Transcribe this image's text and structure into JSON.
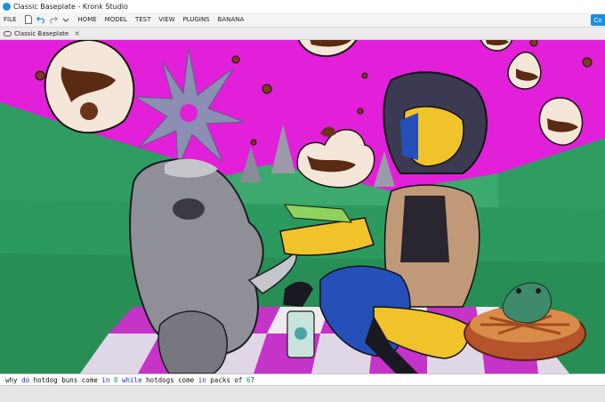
{
  "window": {
    "title": "Classic Baseplate - Kronk Studio"
  },
  "menubar": {
    "items": [
      "FILE",
      "HOME",
      "MODEL",
      "TEST",
      "VIEW",
      "PLUGINS",
      "BANANA"
    ],
    "right_button_label": "Co"
  },
  "tabs": [
    {
      "label": "Classic Baseplate"
    }
  ],
  "command_bar": {
    "segments": [
      {
        "text": "why ",
        "color": "#111111"
      },
      {
        "text": "do",
        "color": "#1a2fd0"
      },
      {
        "text": " hotdog buns come ",
        "color": "#111111"
      },
      {
        "text": "in",
        "color": "#1a2fd0"
      },
      {
        "text": " ",
        "color": "#111111"
      },
      {
        "text": "8",
        "color": "#1a8a8a"
      },
      {
        "text": " ",
        "color": "#111111"
      },
      {
        "text": "while",
        "color": "#1a2fd0"
      },
      {
        "text": " hotdogs come ",
        "color": "#111111"
      },
      {
        "text": "in",
        "color": "#1a2fd0"
      },
      {
        "text": " packs of ",
        "color": "#111111"
      },
      {
        "text": "6",
        "color": "#1a8a8a"
      },
      {
        "text": "?",
        "color": "#111111"
      }
    ]
  },
  "colors": {
    "sky": "#e21fd9",
    "grass": "#2f9d62",
    "grass_dark": "#1f7f4a",
    "accent": "#1c8fe0",
    "checker_white": "#eeeaf0",
    "checker_purple": "#c533c8"
  }
}
